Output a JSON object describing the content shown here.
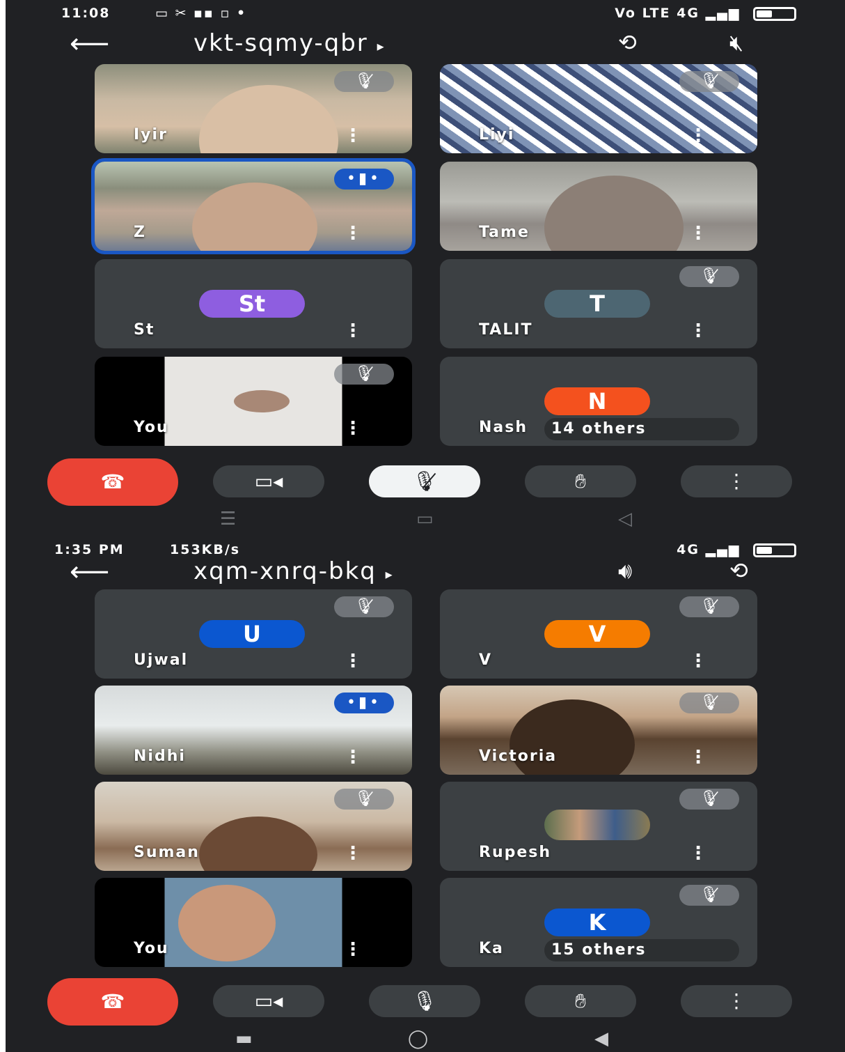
{
  "screen1": {
    "status": {
      "time": "11:08",
      "right": "Vo LTE 4G"
    },
    "meeting_code": "vkt-sqmy-qbr",
    "tiles": [
      {
        "name": "Iyir",
        "muted": true
      },
      {
        "name": "Liyi",
        "muted": true
      },
      {
        "name": "Z",
        "speaking": true
      },
      {
        "name": "Tame"
      },
      {
        "name": "St",
        "avatar": "St",
        "avatar_color": "#8e5ee0"
      },
      {
        "name": "TALIT",
        "avatar": "T",
        "avatar_color": "#4d6672",
        "muted": true
      },
      {
        "name": "You",
        "muted": true
      },
      {
        "name": "Nash",
        "avatar": "N",
        "avatar_color": "#f4511e",
        "others": "14 others"
      }
    ],
    "controls": [
      "end-call",
      "camera",
      "mic-off",
      "raise-hand",
      "more"
    ]
  },
  "screen2": {
    "status": {
      "time": "1:35 PM",
      "net": "153KB/s",
      "right": "4G"
    },
    "meeting_code": "xqm-xnrq-bkq",
    "tiles": [
      {
        "name": "Ujwal",
        "avatar": "U",
        "avatar_color": "#0b57d0",
        "muted": true
      },
      {
        "name": "V",
        "avatar": "V",
        "avatar_color": "#f57c00",
        "muted": true
      },
      {
        "name": "Nidhi",
        "speaking": true
      },
      {
        "name": "Victoria",
        "muted": true
      },
      {
        "name": "Suman",
        "muted": true
      },
      {
        "name": "Rupesh",
        "muted": true
      },
      {
        "name": "You"
      },
      {
        "name": "Ka",
        "avatar": "K",
        "avatar_color": "#0b57d0",
        "muted": true,
        "others": "15 others"
      }
    ],
    "controls": [
      "end-call",
      "camera",
      "mic-on",
      "raise-hand",
      "more"
    ]
  }
}
